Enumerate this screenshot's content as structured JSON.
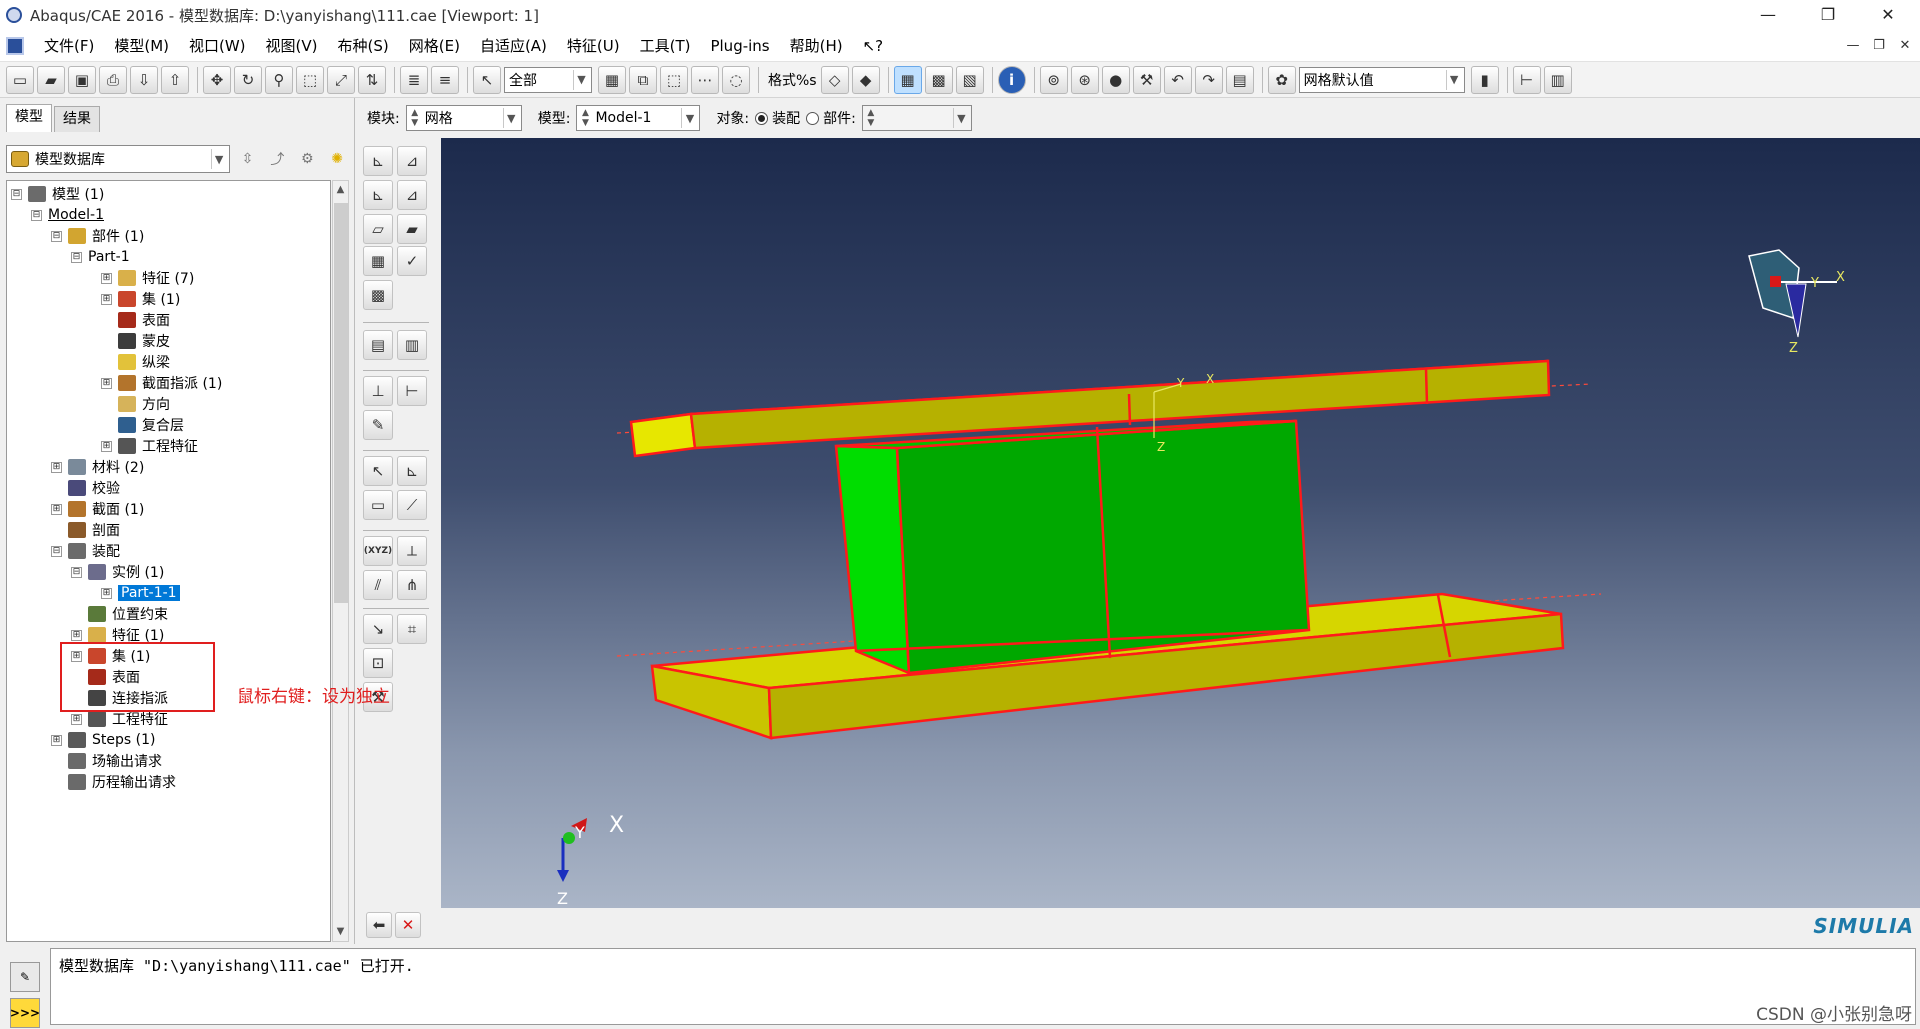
{
  "window": {
    "title": "Abaqus/CAE 2016 - 模型数据库: D:\\yanyishang\\111.cae [Viewport: 1]"
  },
  "menu": {
    "items": [
      "文件(F)",
      "模型(M)",
      "视口(W)",
      "视图(V)",
      "布种(S)",
      "网格(E)",
      "自适应(A)",
      "特征(U)",
      "工具(T)",
      "Plug-ins",
      "帮助(H)",
      "↖?"
    ]
  },
  "toolbar": {
    "filter_select": "全部",
    "render_style_text": "格式%s",
    "mesh_defaults_select": "网格默认值"
  },
  "tabs": [
    "模型",
    "结果"
  ],
  "tree_header": {
    "select": "模型数据库"
  },
  "tree": {
    "rows": [
      {
        "label": "模型 (1)",
        "exp": "⊟"
      },
      {
        "label": "Model-1",
        "exp": "⊟"
      },
      {
        "label": "部件 (1)",
        "exp": "⊟"
      },
      {
        "label": "Part-1",
        "exp": "⊟"
      },
      {
        "label": "特征 (7)",
        "exp": "⊞"
      },
      {
        "label": "集 (1)",
        "exp": "⊞"
      },
      {
        "label": "表面",
        "exp": ""
      },
      {
        "label": "蒙皮",
        "exp": ""
      },
      {
        "label": "纵梁",
        "exp": ""
      },
      {
        "label": "截面指派 (1)",
        "exp": "⊞"
      },
      {
        "label": "方向",
        "exp": ""
      },
      {
        "label": "复合层",
        "exp": ""
      },
      {
        "label": "工程特征",
        "exp": "⊞"
      },
      {
        "label": "材料 (2)",
        "exp": "⊞"
      },
      {
        "label": "校验",
        "exp": ""
      },
      {
        "label": "截面 (1)",
        "exp": "⊞"
      },
      {
        "label": "剖面",
        "exp": ""
      },
      {
        "label": "装配",
        "exp": "⊟"
      },
      {
        "label": "实例 (1)",
        "exp": "⊟"
      },
      {
        "label": "Part-1-1",
        "exp": "⊞"
      },
      {
        "label": "位置约束",
        "exp": ""
      },
      {
        "label": "特征 (1)",
        "exp": "⊞"
      },
      {
        "label": "集 (1)",
        "exp": "⊞"
      },
      {
        "label": "表面",
        "exp": ""
      },
      {
        "label": "连接指派",
        "exp": ""
      },
      {
        "label": "工程特征",
        "exp": "⊞"
      },
      {
        "label": "Steps (1)",
        "exp": "⊞"
      },
      {
        "label": "场输出请求",
        "exp": ""
      },
      {
        "label": "历程输出请求",
        "exp": ""
      }
    ]
  },
  "module_bar": {
    "module_label": "模块:",
    "module_value": "网格",
    "model_label": "模型:",
    "model_value": "Model-1",
    "object_label": "对象:",
    "assembly_option": "装配",
    "part_option": "部件:",
    "part_value": ""
  },
  "viewport": {
    "mini_axis_x": "X",
    "mini_axis_y": "Y",
    "mini_axis_z": "Z",
    "part_axis_y": "Y",
    "part_axis_x": "X",
    "part_axis_z": "Z",
    "view_axis_x": "X",
    "view_axis_y": "Y",
    "view_axis_z": "Z"
  },
  "brand": "SIMULIA",
  "message": "模型数据库 \"D:\\yanyishang\\111.cae\" 已打开.",
  "annotation": {
    "text": "鼠标右键：设为独立"
  },
  "watermark": "CSDN @小张别急呀",
  "colors": {
    "viewport_top": "#1c2a4c",
    "viewport_bottom": "#aab5c7",
    "plate_yellow": "#d6d600",
    "block_green": "#00c800",
    "edge_red": "#ff1a1a",
    "selection_blue": "#0078d7",
    "annotation_red": "#e01e1e"
  }
}
